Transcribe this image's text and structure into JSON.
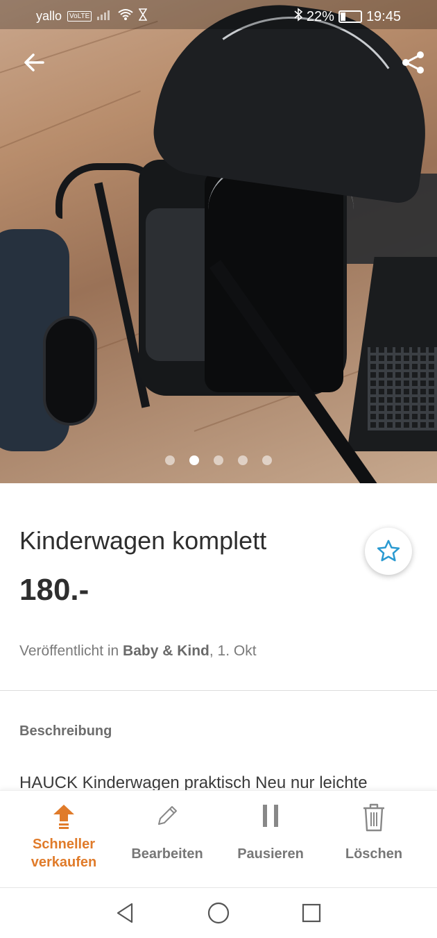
{
  "status_bar": {
    "carrier": "yallo",
    "volte": "VoLTE",
    "battery": "22%",
    "time": "19:45"
  },
  "gallery": {
    "image_count": 5,
    "active_index": 1
  },
  "listing": {
    "title": "Kinderwagen komplett",
    "price": "180.-",
    "published_prefix": "Veröffentlicht in ",
    "category": "Baby & Kind",
    "published_suffix": ", 1. Okt"
  },
  "description": {
    "heading": "Beschreibung",
    "text": "HAUCK Kinderwagen praktisch Neu nur leichte"
  },
  "actions": {
    "sell_faster_line1": "Schneller",
    "sell_faster_line2": "verkaufen",
    "edit": "Bearbeiten",
    "pause": "Pausieren",
    "delete": "Löschen"
  },
  "colors": {
    "accent": "#e07b2a",
    "star": "#2a9ad1"
  },
  "icons": [
    "back-arrow-icon",
    "share-icon",
    "star-icon",
    "upload-arrow-icon",
    "pencil-icon",
    "pause-icon",
    "trash-icon",
    "nav-back-icon",
    "nav-home-icon",
    "nav-recents-icon"
  ]
}
